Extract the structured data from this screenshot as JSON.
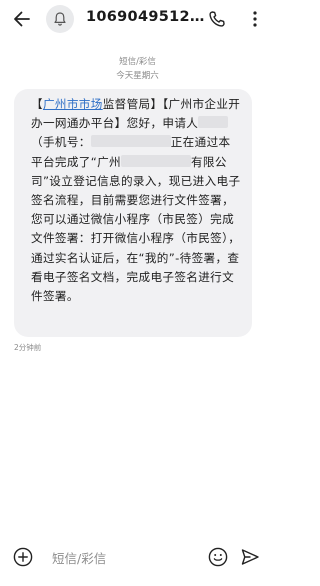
{
  "header": {
    "contact_name": "1069049512…",
    "back_icon": "back-arrow-icon",
    "avatar_icon": "bell-icon",
    "call_icon": "phone-icon",
    "more_icon": "more-vertical-icon"
  },
  "thread": {
    "message_type": "短信/彩信",
    "date_label": "今天星期六"
  },
  "message": {
    "prefix": "【",
    "link_text": "广州市市场",
    "part1": "监督管局】【广州市企业开办一网通办平台】",
    "greeting": "您好，申请人",
    "phone_prefix": "（手机号：",
    "part2": "正在通过本平台完成了“广州",
    "part3": "有限公司”设立登记信息的录入，现已进入电子签名流程，目前需要您进行文件签署，您可以通过微信小程序（市民签）完成文件签署：打开微信小程序（市民签），通过实名认证后，在“我的”-待签署，查看电子签名文档，完成电子签名进行文件签署。",
    "time_ago": "2分钟前"
  },
  "composer": {
    "placeholder": "短信/彩信",
    "add_icon": "add-icon",
    "emoji_icon": "emoji-icon",
    "send_icon": "send-icon"
  },
  "colors": {
    "bubble_bg": "#f1f1f3",
    "link": "#2f6fc6",
    "meta_text": "#8a8a8a"
  }
}
